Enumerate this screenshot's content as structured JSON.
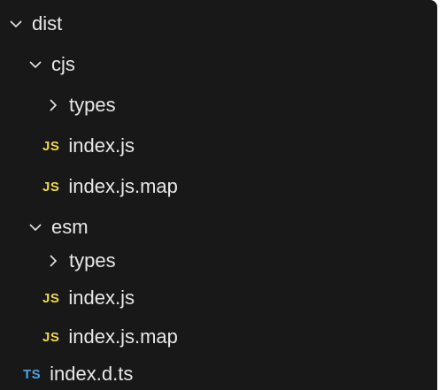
{
  "explorer": {
    "items": [
      {
        "label": "dist"
      },
      {
        "label": "cjs"
      },
      {
        "label": "types"
      },
      {
        "label": "index.js",
        "badge": "JS"
      },
      {
        "label": "index.js.map",
        "badge": "JS"
      },
      {
        "label": "esm"
      },
      {
        "label": "types"
      },
      {
        "label": "index.js",
        "badge": "JS"
      },
      {
        "label": "index.js.map",
        "badge": "JS"
      },
      {
        "label": "index.d.ts",
        "badge": "TS"
      }
    ]
  },
  "colors": {
    "background": "#181818",
    "text": "#e8e8e8",
    "js_badge": "#f0d84e",
    "ts_badge": "#4fa3e3"
  },
  "icons": {
    "expanded": "chevron-down-icon",
    "collapsed": "chevron-right-icon",
    "js_file": "js-file-icon",
    "ts_file": "ts-file-icon"
  }
}
